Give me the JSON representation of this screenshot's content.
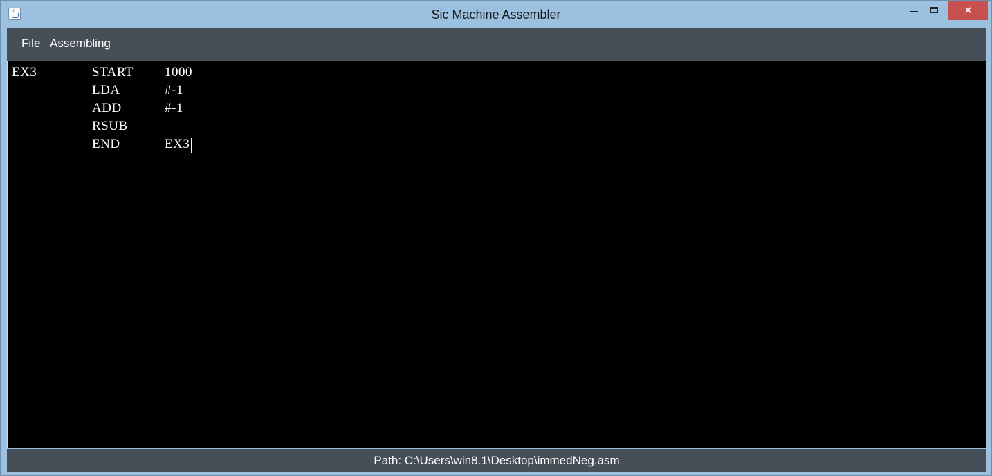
{
  "window": {
    "title": "Sic Machine Assembler",
    "icon": "java-cup-icon",
    "controls": {
      "minimize": "minimize-icon",
      "maximize": "maximize-icon",
      "close": "close-icon",
      "close_glyph": "✕"
    }
  },
  "menubar": {
    "items": [
      {
        "label": "File"
      },
      {
        "label": "Assembling"
      }
    ]
  },
  "editor": {
    "lines": [
      {
        "label": "EX3",
        "opcode": "START",
        "operand": "1000"
      },
      {
        "label": "",
        "opcode": "LDA",
        "operand": "#-1"
      },
      {
        "label": "",
        "opcode": "ADD",
        "operand": "#-1"
      },
      {
        "label": "",
        "opcode": "RSUB",
        "operand": ""
      },
      {
        "label": "",
        "opcode": "END",
        "operand": "EX3"
      }
    ]
  },
  "statusbar": {
    "path_text": "Path: C:\\Users\\win8.1\\Desktop\\immedNeg.asm"
  },
  "colors": {
    "titlebar": "#9cc0e0",
    "menubar": "#464e58",
    "editor_bg": "#000000",
    "editor_text": "#ffffff",
    "close_button": "#c75050"
  }
}
